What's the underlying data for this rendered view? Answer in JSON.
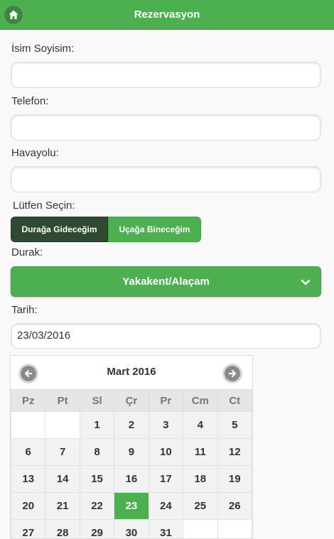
{
  "header": {
    "title": "Rezervasyon",
    "home_icon": "home-icon"
  },
  "form": {
    "name_label": "İsim Soyisim:",
    "name_value": "",
    "phone_label": "Telefon:",
    "phone_value": "",
    "airline_label": "Havayolu:",
    "airline_value": "",
    "choose_label": "Lütfen Seçin:",
    "option_station": "Durağa Gideceğim",
    "option_plane": "Uçağa Bineceğim",
    "stop_label": "Durak:",
    "stop_value": "Yakakent/Alaçam",
    "date_label": "Tarih:",
    "date_value": "23/03/2016"
  },
  "calendar": {
    "month_title": "Mart 2016",
    "weekdays": [
      "Pz",
      "Pt",
      "Sl",
      "Çr",
      "Pr",
      "Cm",
      "Ct"
    ],
    "weeks": [
      [
        "",
        "",
        "1",
        "2",
        "3",
        "4",
        "5"
      ],
      [
        "6",
        "7",
        "8",
        "9",
        "10",
        "11",
        "12"
      ],
      [
        "13",
        "14",
        "15",
        "16",
        "17",
        "18",
        "19"
      ],
      [
        "20",
        "21",
        "22",
        "23",
        "24",
        "25",
        "26"
      ],
      [
        "27",
        "28",
        "29",
        "30",
        "31",
        "",
        ""
      ]
    ],
    "selected_day": "23"
  },
  "colors": {
    "accent": "#4caf50",
    "active_segment": "#2f4a30"
  }
}
